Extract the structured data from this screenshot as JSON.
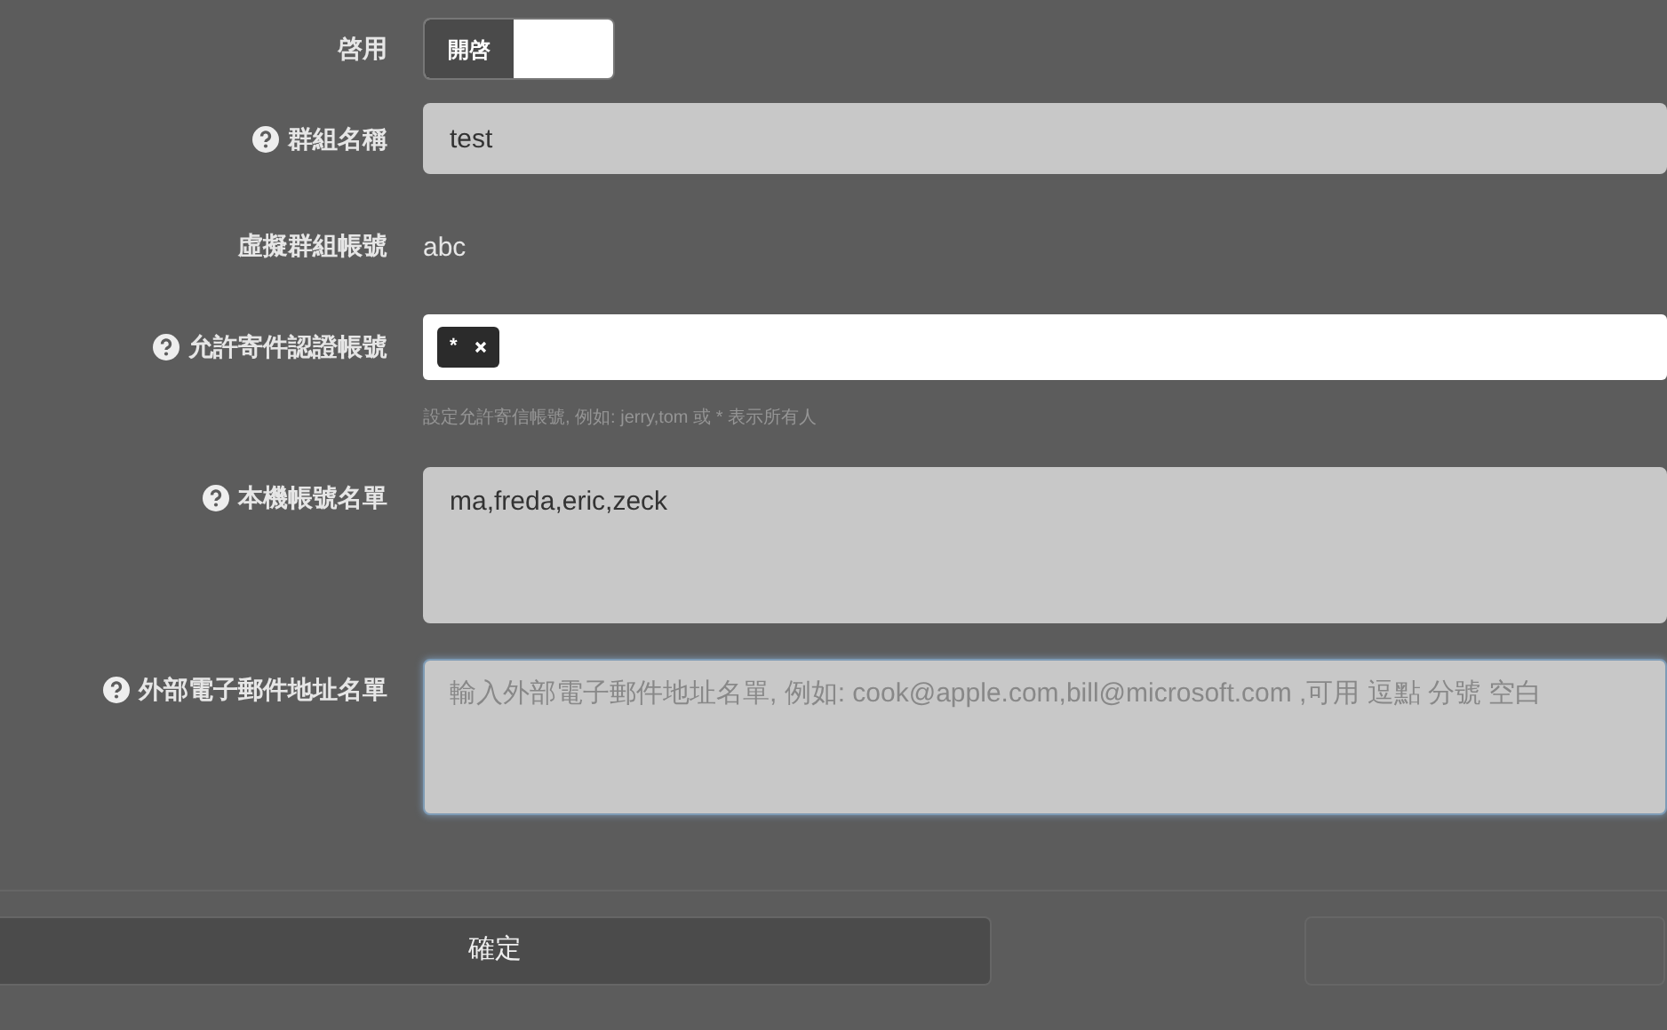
{
  "form": {
    "rows": [
      {
        "kind": "switch",
        "label": "啓用",
        "help": false,
        "switch_label": "開啓",
        "on": true
      },
      {
        "kind": "input",
        "label": "群組名稱",
        "help": true,
        "value": "test"
      },
      {
        "kind": "text",
        "label": "虛擬群組帳號",
        "help": false,
        "value": "abc"
      },
      {
        "kind": "tags",
        "label": "允許寄件認證帳號",
        "help": true,
        "tags": [
          "*"
        ],
        "hint": "設定允許寄信帳號, 例如: jerry,tom 或 * 表示所有人"
      },
      {
        "kind": "textarea",
        "label": "本機帳號名單",
        "help": true,
        "value": "ma,freda,eric,zeck",
        "focused": false
      },
      {
        "kind": "textarea",
        "label": "外部電子郵件地址名單",
        "help": true,
        "placeholder": "輸入外部電子郵件地址名單, 例如: cook@apple.com,bill@microsoft.com ,可用 逗點 分號 空白",
        "focused": true
      }
    ]
  },
  "buttons": [
    {
      "label": "確定",
      "kind": "primary"
    },
    {
      "kind": "secondary"
    }
  ]
}
